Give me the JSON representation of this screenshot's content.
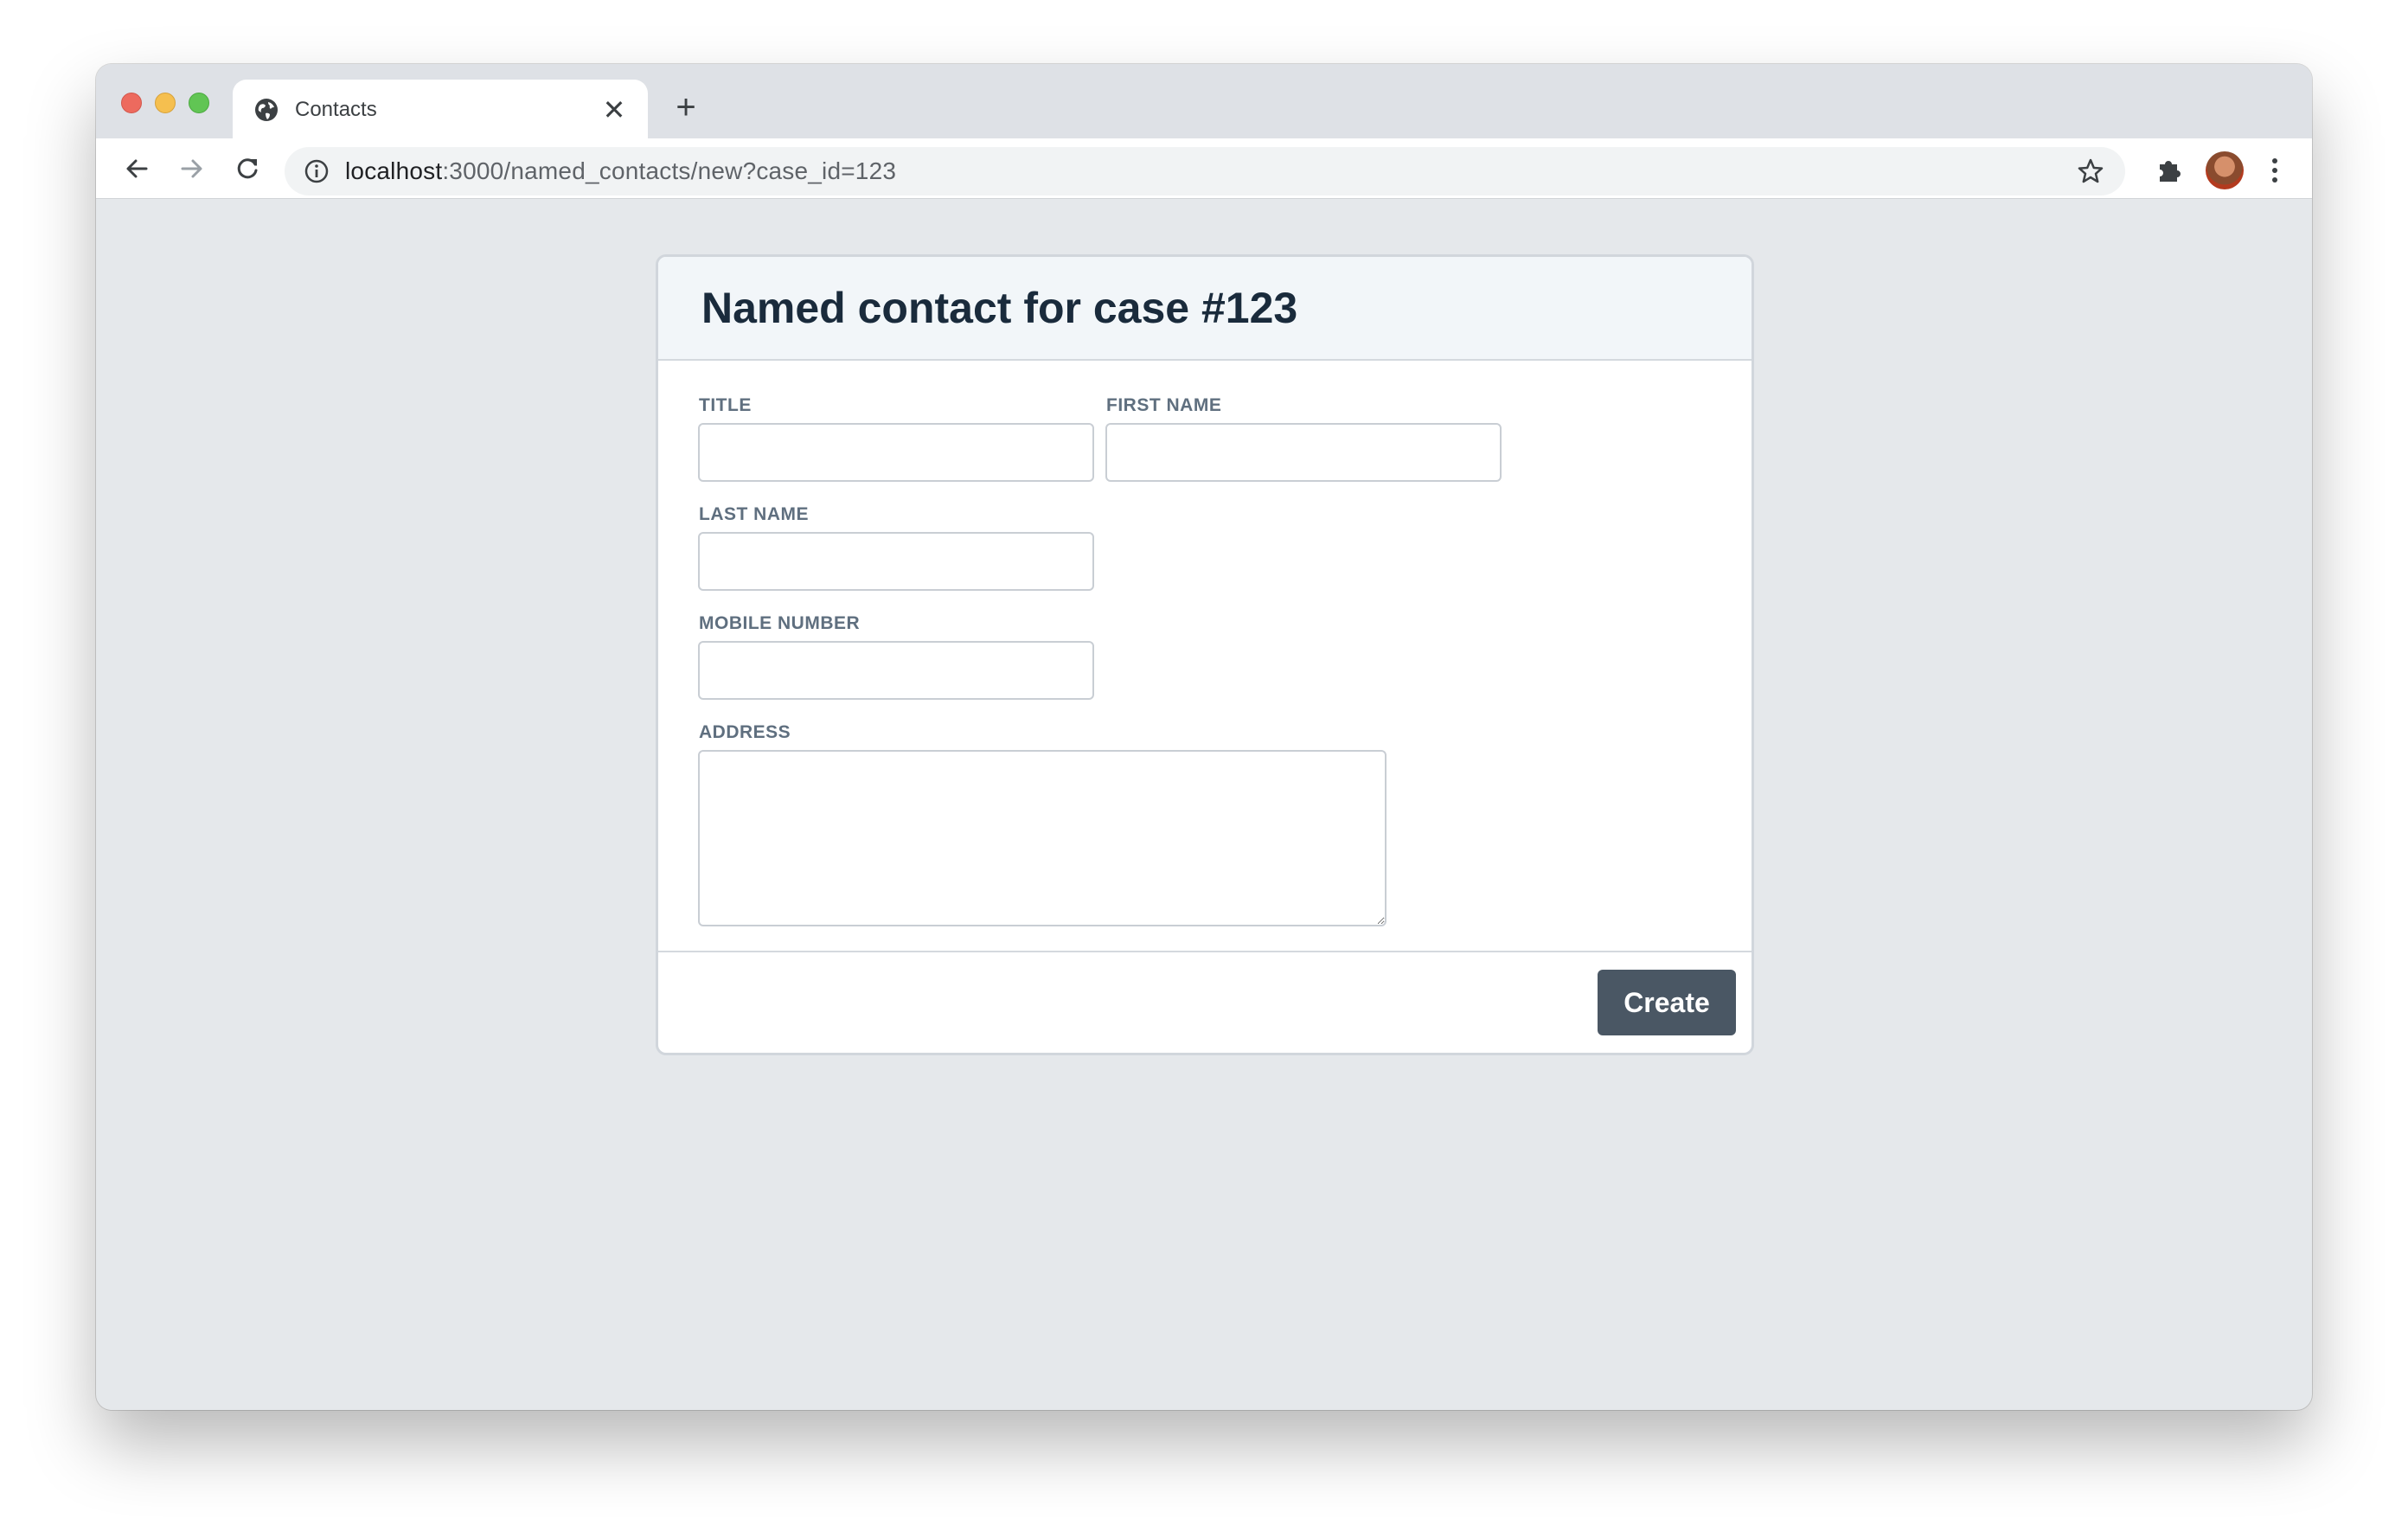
{
  "browser": {
    "tab_title": "Contacts",
    "tab_close_glyph": "✕",
    "new_tab_glyph": "+",
    "url_host": "localhost",
    "url_rest": ":3000/named_contacts/new?case_id=123",
    "icons": [
      "globe-icon",
      "back-arrow-icon",
      "forward-arrow-icon",
      "reload-icon",
      "info-icon",
      "star-icon",
      "extensions-icon",
      "profile-avatar",
      "more-menu-icon"
    ]
  },
  "form": {
    "heading": "Named contact for case #123",
    "fields": {
      "title": {
        "label": "TITLE",
        "value": ""
      },
      "first_name": {
        "label": "FIRST NAME",
        "value": ""
      },
      "last_name": {
        "label": "LAST NAME",
        "value": ""
      },
      "mobile_number": {
        "label": "MOBILE NUMBER",
        "value": ""
      },
      "address": {
        "label": "ADDRESS",
        "value": ""
      }
    },
    "submit_label": "Create"
  },
  "colors": {
    "page_background": "#e5e8eb",
    "heading": "#1a2b3c",
    "button": "#4a5764",
    "label": "#5f6f7f"
  }
}
